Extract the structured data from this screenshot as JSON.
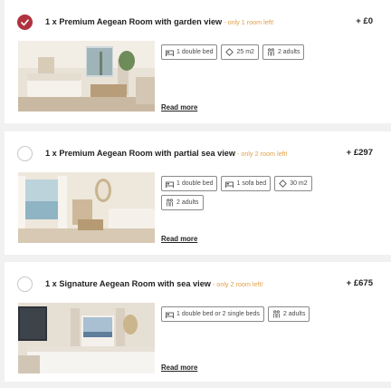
{
  "rooms": [
    {
      "selected": true,
      "title": "1 x Premium Aegean Room with garden view",
      "availability": " - only 1 room left!",
      "price": "+ £0",
      "amenities": [
        {
          "icon": "bed-icon",
          "label": "1 double bed"
        },
        {
          "icon": "area-icon",
          "label": "25 m2"
        },
        {
          "icon": "guests-icon",
          "label": "2 adults"
        }
      ],
      "read_more": "Read more"
    },
    {
      "selected": false,
      "title": "1 x Premium Aegean Room with partial sea view",
      "availability": " - only 2 room left!",
      "price": "+ £297",
      "amenities": [
        {
          "icon": "bed-icon",
          "label": "1 double bed"
        },
        {
          "icon": "sofa-bed-icon",
          "label": "1 sofa bed"
        },
        {
          "icon": "area-icon",
          "label": "30 m2"
        },
        {
          "icon": "guests-icon",
          "label": "2 adults"
        }
      ],
      "read_more": "Read more"
    },
    {
      "selected": false,
      "title": "1 x Signature Aegean Room with sea view",
      "availability": " - only 2 room left!",
      "price": "+ £675",
      "amenities": [
        {
          "icon": "bed-icon",
          "label": "1 double bed or 2 single beds"
        },
        {
          "icon": "guests-icon",
          "label": "2 adults"
        }
      ],
      "read_more": "Read more"
    }
  ],
  "colors": {
    "accent": "#b0323f",
    "availability": "#e0a04a"
  }
}
